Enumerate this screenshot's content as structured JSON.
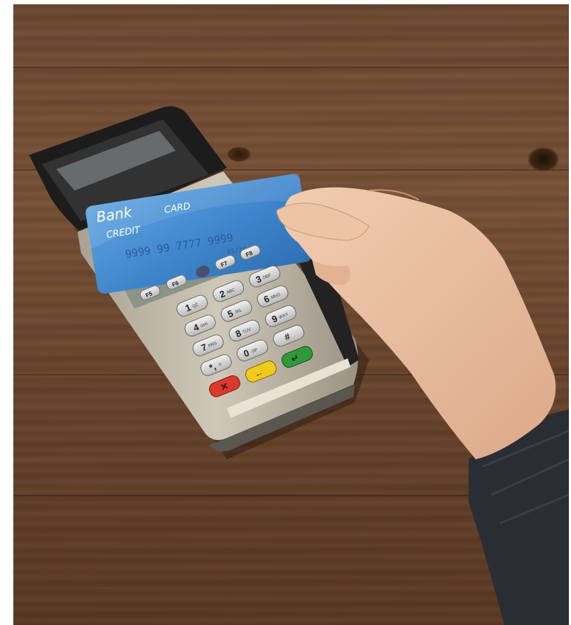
{
  "photo": {
    "subject": "hand inserting credit card into payment terminal",
    "colors": {
      "wood": "#6e4a31",
      "card": "#4d8fd0",
      "terminal": "#c9c2b3",
      "red_key": "#d93a2b",
      "yellow_key": "#f0cc18",
      "green_key": "#2f9a3a"
    }
  },
  "card": {
    "brand": "Bank",
    "line1": "CREDIT",
    "line2": "CARD",
    "number": "9999 99  7777  9999",
    "expiry": "05/24"
  },
  "keypad": {
    "function_keys": [
      "F5",
      "F6",
      "F7",
      "F8"
    ],
    "keys": [
      {
        "label": "1",
        "sub": "QZ."
      },
      {
        "label": "2",
        "sub": "ABC"
      },
      {
        "label": "3",
        "sub": "DEF"
      },
      {
        "label": "4",
        "sub": "GHI"
      },
      {
        "label": "5",
        "sub": "JKL"
      },
      {
        "label": "6",
        "sub": "MNO"
      },
      {
        "label": "7",
        "sub": "PRS"
      },
      {
        "label": "8",
        "sub": "TUV"
      },
      {
        "label": "9",
        "sub": "WXY"
      },
      {
        "label": "*,",
        "sub": "#"
      },
      {
        "label": "0",
        "sub": "-SP"
      },
      {
        "label": "#",
        "sub": ""
      }
    ]
  }
}
